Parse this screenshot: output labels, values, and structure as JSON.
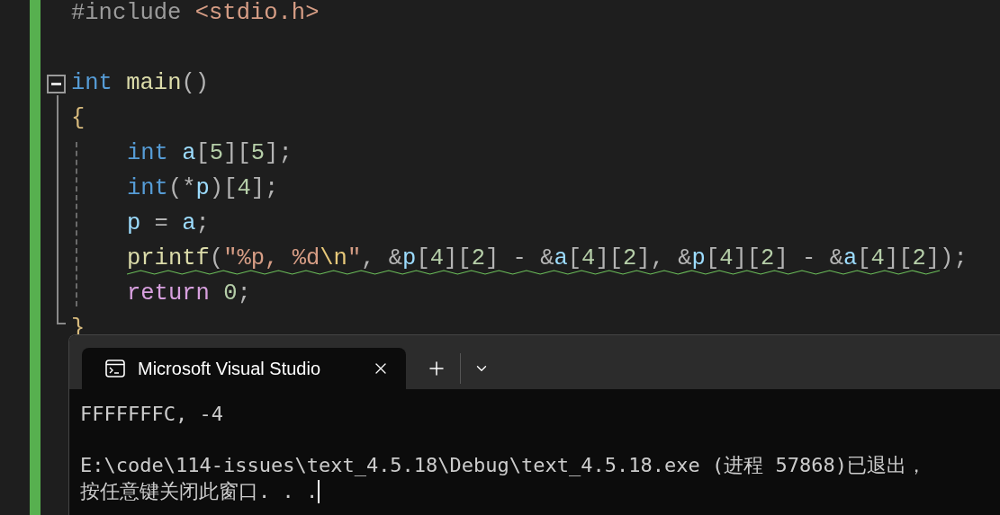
{
  "editor": {
    "lines": [
      {
        "kind": "code",
        "tokens": [
          {
            "kind": "preprocessor",
            "text": "#include "
          },
          {
            "kind": "string",
            "text": "<stdio.h>"
          }
        ]
      },
      {
        "kind": "blank"
      },
      {
        "kind": "code",
        "fold": {
          "expanded": true
        },
        "tokens": [
          {
            "kind": "keyword",
            "text": "int "
          },
          {
            "kind": "function",
            "text": "main"
          },
          {
            "kind": "punct",
            "text": "()"
          }
        ]
      },
      {
        "kind": "code",
        "tokens": [
          {
            "kind": "brace",
            "text": "{"
          }
        ],
        "children": [
          {
            "kind": "code",
            "tokens": [
              {
                "kind": "keyword",
                "text": "int "
              },
              {
                "kind": "variable",
                "text": "a"
              },
              {
                "kind": "punct",
                "text": "["
              },
              {
                "kind": "number",
                "text": "5"
              },
              {
                "kind": "punct",
                "text": "]["
              },
              {
                "kind": "number",
                "text": "5"
              },
              {
                "kind": "punct",
                "text": "];"
              }
            ]
          },
          {
            "kind": "code",
            "tokens": [
              {
                "kind": "keyword",
                "text": "int"
              },
              {
                "kind": "punct",
                "text": "(*"
              },
              {
                "kind": "variable",
                "text": "p"
              },
              {
                "kind": "punct",
                "text": ")["
              },
              {
                "kind": "number",
                "text": "4"
              },
              {
                "kind": "punct",
                "text": "];"
              }
            ]
          },
          {
            "kind": "code",
            "tokens": [
              {
                "kind": "variable",
                "text": "p"
              },
              {
                "kind": "punct",
                "text": " = "
              },
              {
                "kind": "variable",
                "text": "a"
              },
              {
                "kind": "punct",
                "text": ";"
              }
            ]
          },
          {
            "kind": "code",
            "warning": true,
            "tokens": [
              {
                "kind": "function",
                "text": "printf"
              },
              {
                "kind": "punct",
                "text": "("
              },
              {
                "kind": "string",
                "text": "\"%p, %d"
              },
              {
                "kind": "escape",
                "text": "\\n"
              },
              {
                "kind": "string",
                "text": "\""
              },
              {
                "kind": "punct",
                "text": ", &"
              },
              {
                "kind": "variable",
                "text": "p"
              },
              {
                "kind": "punct",
                "text": "["
              },
              {
                "kind": "number",
                "text": "4"
              },
              {
                "kind": "punct",
                "text": "]["
              },
              {
                "kind": "number",
                "text": "2"
              },
              {
                "kind": "punct",
                "text": "] - &"
              },
              {
                "kind": "variable",
                "text": "a"
              },
              {
                "kind": "punct",
                "text": "["
              },
              {
                "kind": "number",
                "text": "4"
              },
              {
                "kind": "punct",
                "text": "]["
              },
              {
                "kind": "number",
                "text": "2"
              },
              {
                "kind": "punct",
                "text": "], &"
              },
              {
                "kind": "variable",
                "text": "p"
              },
              {
                "kind": "punct",
                "text": "["
              },
              {
                "kind": "number",
                "text": "4"
              },
              {
                "kind": "punct",
                "text": "]["
              },
              {
                "kind": "number",
                "text": "2"
              },
              {
                "kind": "punct",
                "text": "] - &"
              },
              {
                "kind": "variable",
                "text": "a"
              },
              {
                "kind": "punct",
                "text": "["
              },
              {
                "kind": "number",
                "text": "4"
              },
              {
                "kind": "punct",
                "text": "]["
              },
              {
                "kind": "number",
                "text": "2"
              },
              {
                "kind": "punct",
                "text": "])"
              },
              {
                "kind": "punct",
                "text": ";"
              }
            ]
          },
          {
            "kind": "code",
            "tokens": [
              {
                "kind": "control",
                "text": "return "
              },
              {
                "kind": "number",
                "text": "0"
              },
              {
                "kind": "punct",
                "text": ";"
              }
            ]
          }
        ]
      },
      {
        "kind": "code",
        "tokens": [
          {
            "kind": "brace",
            "text": "}"
          }
        ]
      }
    ]
  },
  "terminal": {
    "tab": {
      "title": "Microsoft Visual Studio",
      "selected": true
    },
    "output": [
      {
        "kind": "text",
        "text": "FFFFFFFC, -4"
      },
      {
        "kind": "blank"
      },
      {
        "kind": "text",
        "text": "E:\\code\\114-issues\\text_4.5.18\\Debug\\text_4.5.18.exe (进程 57868)已退出，"
      },
      {
        "kind": "text",
        "text": "按任意键关闭此窗口. . .",
        "cursor": true
      }
    ]
  }
}
